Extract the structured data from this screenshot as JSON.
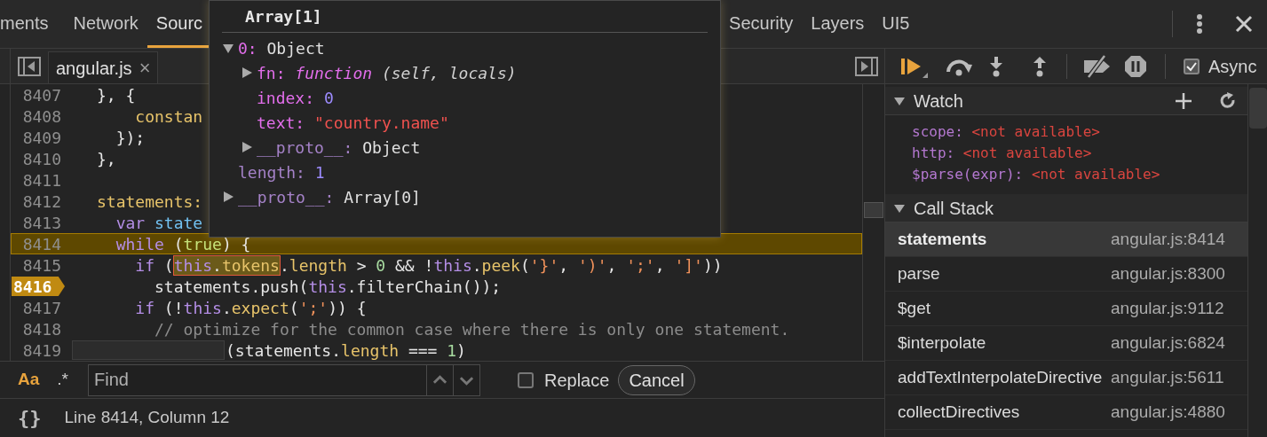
{
  "top_tabs": [
    {
      "label": "ments",
      "selected": false
    },
    {
      "label": "Network",
      "selected": false
    },
    {
      "label": "Sourc",
      "selected": true
    },
    {
      "label": "Security",
      "selected": false
    },
    {
      "label": "Layers",
      "selected": false
    },
    {
      "label": "UI5",
      "selected": false
    }
  ],
  "editor_tabs": [
    {
      "label": "angular.js",
      "close": "×",
      "selected": true
    }
  ],
  "code_lines": [
    {
      "number": "8407",
      "tokens": [
        {
          "text": "}, {",
          "kind": "plain"
        }
      ]
    },
    {
      "number": "8408",
      "tokens": [
        {
          "text": "    constan",
          "kind": "prop"
        }
      ]
    },
    {
      "number": "8409",
      "tokens": [
        {
          "text": "  });",
          "kind": "plain"
        }
      ]
    },
    {
      "number": "8410",
      "tokens": [
        {
          "text": "},",
          "kind": "plain"
        }
      ]
    },
    {
      "number": "8411"
    },
    {
      "number": "8412",
      "tokens": [
        {
          "text": "statements:",
          "kind": "prop"
        }
      ]
    },
    {
      "number": "8413",
      "tokens": [
        {
          "text": "  var",
          "kind": "kw"
        },
        {
          "text": " state",
          "kind": "var"
        }
      ]
    },
    {
      "number": "8414",
      "highlighted": true,
      "tokens": [
        {
          "text": "  while",
          "kind": "kw"
        },
        {
          "text": " (",
          "kind": "plain"
        },
        {
          "text": "true",
          "kind": "lit"
        },
        {
          "text": ") {",
          "kind": "plain"
        }
      ]
    },
    {
      "number": "8415",
      "tokens": [
        {
          "text": "    if",
          "kind": "kw"
        },
        {
          "text": " (",
          "kind": "plain"
        },
        {
          "text": "this",
          "kind": "kw",
          "hovered": true
        },
        {
          "text": ".",
          "kind": "plain",
          "hovered": true
        },
        {
          "text": "tokens",
          "kind": "prop",
          "hovered": true
        },
        {
          "text": ".",
          "kind": "plain"
        },
        {
          "text": "length",
          "kind": "prop"
        },
        {
          "text": " > ",
          "kind": "plain"
        },
        {
          "text": "0",
          "kind": "num"
        },
        {
          "text": " && !",
          "kind": "plain"
        },
        {
          "text": "this",
          "kind": "kw"
        },
        {
          "text": ".",
          "kind": "plain"
        },
        {
          "text": "peek",
          "kind": "prop"
        },
        {
          "text": "(",
          "kind": "plain"
        },
        {
          "text": "'}'",
          "kind": "str"
        },
        {
          "text": ", ",
          "kind": "plain"
        },
        {
          "text": "')'",
          "kind": "str"
        },
        {
          "text": ", ",
          "kind": "plain"
        },
        {
          "text": "';'",
          "kind": "str"
        },
        {
          "text": ", ",
          "kind": "plain"
        },
        {
          "text": "']'",
          "kind": "str"
        },
        {
          "text": "))",
          "kind": "plain"
        }
      ]
    },
    {
      "number": "8416",
      "breakpoint": true,
      "tokens": [
        {
          "text": "      statements.push(",
          "kind": "plain"
        },
        {
          "text": "this",
          "kind": "kw"
        },
        {
          "text": ".filterChain());",
          "kind": "plain"
        }
      ]
    },
    {
      "number": "8417",
      "tokens": [
        {
          "text": "    if",
          "kind": "kw"
        },
        {
          "text": " (!",
          "kind": "plain"
        },
        {
          "text": "this",
          "kind": "kw"
        },
        {
          "text": ".",
          "kind": "plain"
        },
        {
          "text": "expect",
          "kind": "prop"
        },
        {
          "text": "(",
          "kind": "plain"
        },
        {
          "text": "';'",
          "kind": "str"
        },
        {
          "text": ")) {",
          "kind": "plain"
        }
      ]
    },
    {
      "number": "8418",
      "tokens": [
        {
          "text": "      // optimize for the common case where there is only one statement.",
          "kind": "com"
        }
      ]
    },
    {
      "number": "8419",
      "covered": true,
      "tokens": [
        {
          "text": "(statements.",
          "kind": "plain"
        },
        {
          "text": "length",
          "kind": "prop"
        },
        {
          "text": " === ",
          "kind": "plain"
        },
        {
          "text": "1",
          "kind": "num"
        },
        {
          "text": ")",
          "kind": "plain"
        }
      ]
    }
  ],
  "find_bar": {
    "case_toggle": {
      "label": "Aa",
      "on": true
    },
    "regex_toggle": {
      "label": ".*",
      "on": false
    },
    "placeholder": "Find",
    "replace": {
      "label": "Replace",
      "checked": false
    },
    "cancel": "Cancel"
  },
  "status_bar": {
    "format_icon": "{}",
    "position": "Line 8414, Column 12"
  },
  "popover": {
    "title": "Array[1]",
    "tree": [
      {
        "key": "0:",
        "value": "Object",
        "kind": "object",
        "expanded": true,
        "children": [
          {
            "key": "fn:",
            "keyword": "function",
            "value": "(self, locals)",
            "kind": "function",
            "expanded": false
          },
          {
            "key": "index:",
            "value": "0",
            "kind": "number"
          },
          {
            "key": "text:",
            "value": "\"country.name\"",
            "kind": "string"
          },
          {
            "key": "__proto__:",
            "value": "Object",
            "kind": "object",
            "dim": true,
            "expanded": false
          }
        ]
      },
      {
        "key": "length:",
        "value": "1",
        "kind": "number",
        "dim": true
      },
      {
        "key": "__proto__:",
        "value": "Array[0]",
        "kind": "object",
        "dim": true,
        "expanded": false
      }
    ]
  },
  "debugger_toolbar": {
    "async": {
      "label": "Async",
      "checked": true
    }
  },
  "watch": {
    "title": "Watch",
    "expanded": true,
    "items": [
      {
        "name": "scope:",
        "value": "<not available>"
      },
      {
        "name": "http:",
        "value": "<not available>"
      },
      {
        "name": "$parse(expr):",
        "value": "<not available>"
      }
    ]
  },
  "call_stack": {
    "title": "Call Stack",
    "expanded": true,
    "frames": [
      {
        "function": "statements",
        "location": "angular.js:8414",
        "selected": true
      },
      {
        "function": "parse",
        "location": "angular.js:8300",
        "selected": false
      },
      {
        "function": "$get",
        "location": "angular.js:9112",
        "selected": false
      },
      {
        "function": "$interpolate",
        "location": "angular.js:6824",
        "selected": false
      },
      {
        "function": "addTextInterpolateDirective",
        "location": "angular.js:5611",
        "selected": false
      },
      {
        "function": "collectDirectives",
        "location": "angular.js:4880",
        "selected": false
      }
    ]
  }
}
